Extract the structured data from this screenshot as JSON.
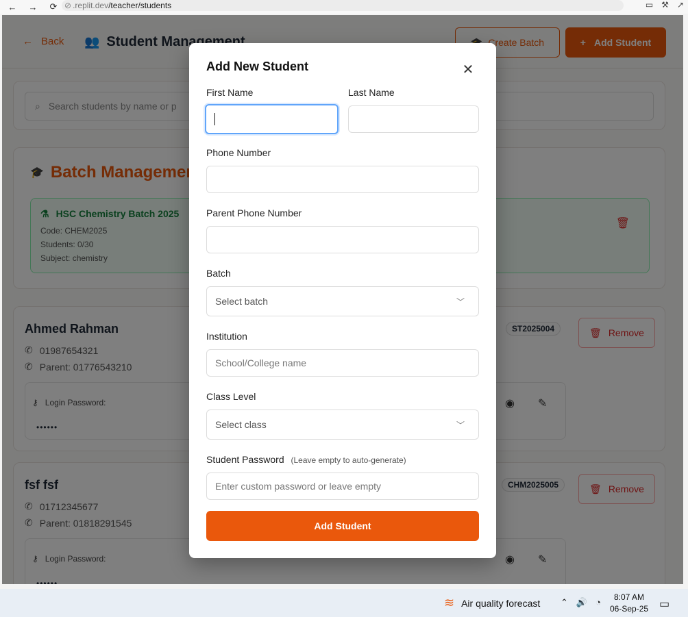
{
  "browser": {
    "back_icon": "←",
    "forward_icon": "→",
    "reload_icon": "⟳",
    "url_prefix": ".replit.dev",
    "url_path": "/teacher/students"
  },
  "page": {
    "back_label": "Back",
    "title": "Student Management",
    "create_batch_label": "Create Batch",
    "add_student_label": "Add Student",
    "search_placeholder": "Search students by name or p",
    "batch_section_title": "Batch Managemen",
    "batch": {
      "name": "HSC Chemistry Batch 2025",
      "code": "Code: CHEM2025",
      "students": "Students: 0/30",
      "subject": "Subject: chemistry"
    },
    "students": [
      {
        "name": "Ahmed Rahman",
        "phone": "01987654321",
        "parent": "Parent: 01776543210",
        "id": "ST2025004",
        "remove_label": "Remove",
        "password_label": "Login Password:",
        "password_mask": "••••••"
      },
      {
        "name": "fsf fsf",
        "phone": "01712345677",
        "parent": "Parent: 01818291545",
        "id": "CHM2025005",
        "remove_label": "Remove",
        "password_label": "Login Password:",
        "password_mask": "••••••"
      }
    ]
  },
  "modal": {
    "title": "Add New Student",
    "close_icon": "✕",
    "first_name_label": "First Name",
    "first_name_value": "",
    "last_name_label": "Last Name",
    "last_name_value": "",
    "phone_label": "Phone Number",
    "phone_value": "",
    "parent_phone_label": "Parent Phone Number",
    "parent_phone_value": "",
    "batch_label": "Batch",
    "batch_placeholder": "Select batch",
    "institution_label": "Institution",
    "institution_placeholder": "School/College name",
    "class_label": "Class Level",
    "class_placeholder": "Select class",
    "password_label": "Student Password",
    "password_hint": "(Leave empty to auto-generate)",
    "password_placeholder": "Enter custom password or leave empty",
    "submit_label": "Add Student"
  },
  "taskbar": {
    "weather_label": "Air quality forecast",
    "time": "8:07 AM",
    "date": "06-Sep-25"
  },
  "colors": {
    "accent": "#ea580c",
    "danger": "#dc2626",
    "success": "#15803d",
    "focus": "#60a5fa"
  }
}
